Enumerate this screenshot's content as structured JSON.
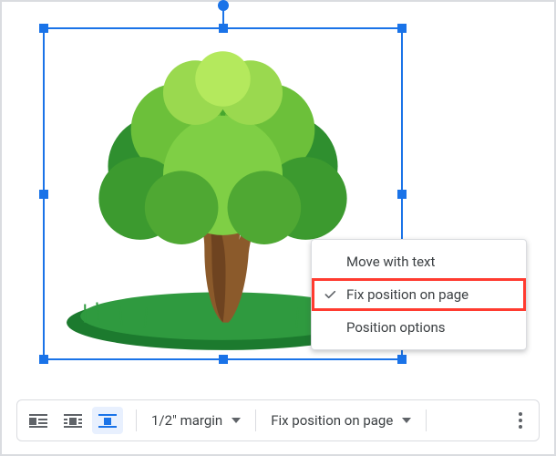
{
  "image": {
    "alt": "Green tree clipart with grass"
  },
  "menu": {
    "items": [
      {
        "label": "Move with text"
      },
      {
        "label": "Fix position on page"
      },
      {
        "label": "Position options"
      }
    ]
  },
  "toolbar": {
    "wrap_modes": {
      "inline": "In line",
      "wrap": "Wrap text",
      "break": "Break text"
    },
    "margin": {
      "label": "1/2\" margin"
    },
    "position": {
      "label": "Fix position on page"
    }
  },
  "colors": {
    "accent": "#1a73e8",
    "highlight": "#ff3b30"
  }
}
